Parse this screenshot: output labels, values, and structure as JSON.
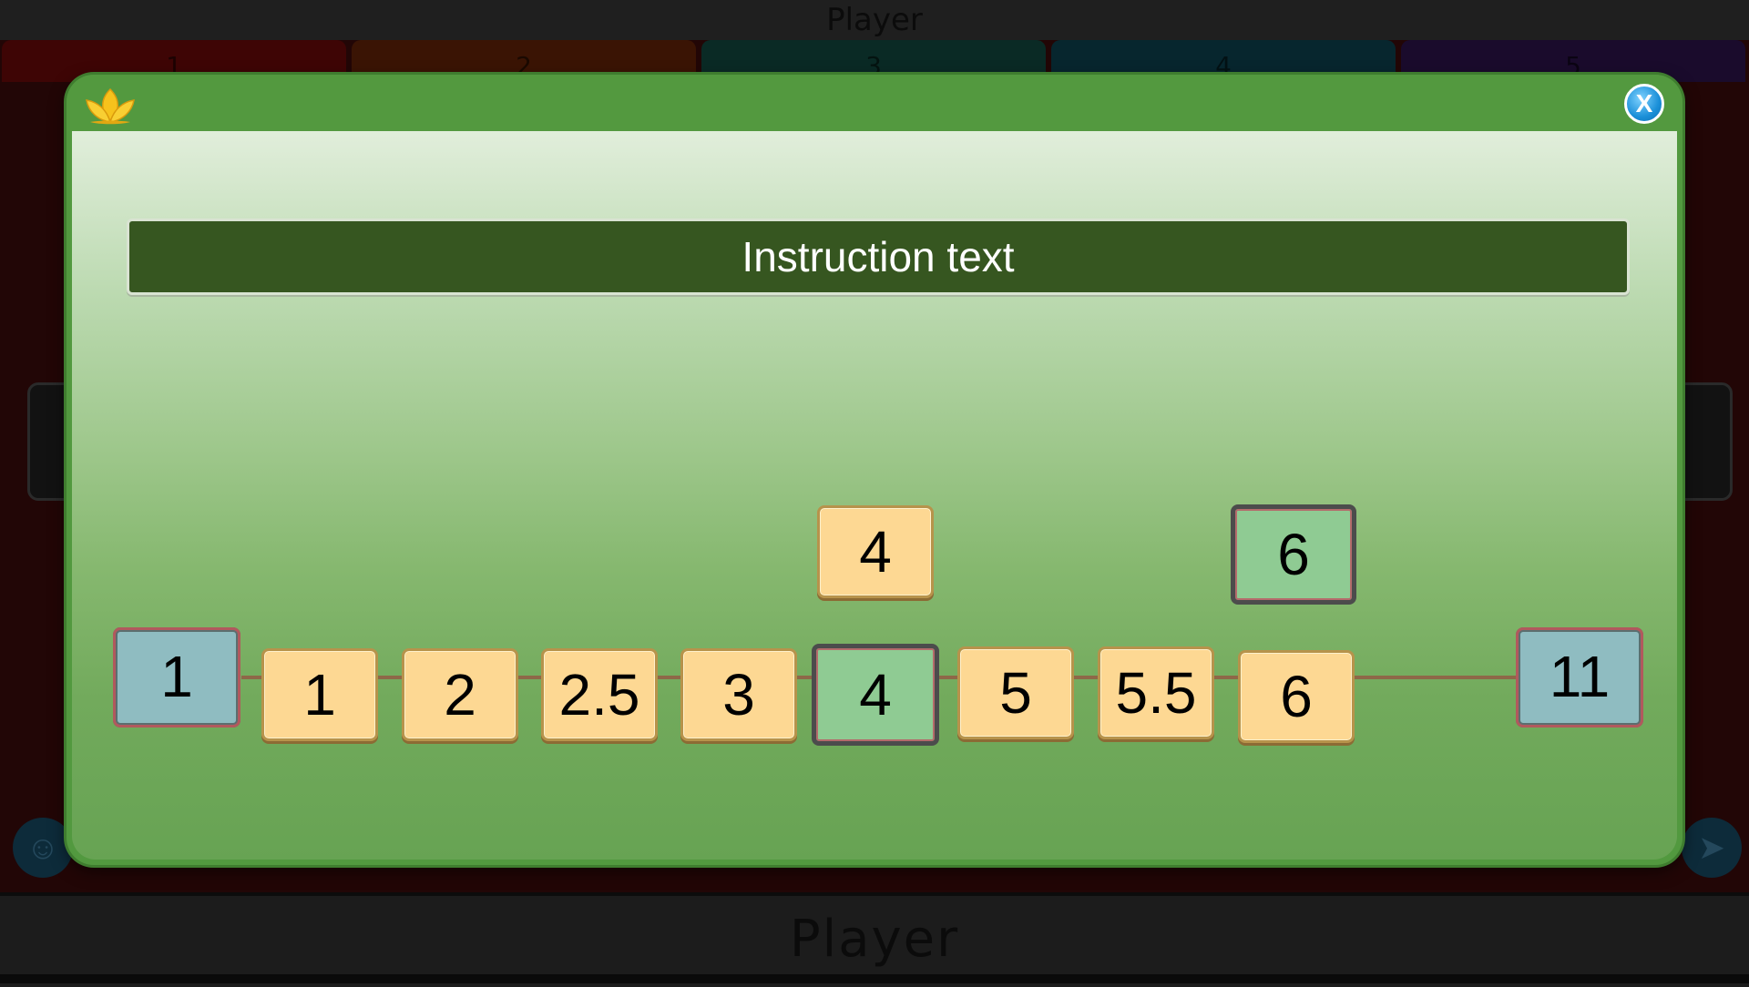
{
  "app": {
    "top_title": "Player",
    "bottom_title": "Player"
  },
  "player_tabs": [
    {
      "label": "1",
      "color": "#3e0505"
    },
    {
      "label": "2",
      "color": "#3a1404"
    },
    {
      "label": "3",
      "color": "#0a2a25"
    },
    {
      "label": "4",
      "color": "#07262e"
    },
    {
      "label": "5",
      "color": "#1a0b2c"
    }
  ],
  "modal": {
    "header_icon": "lotus-icon",
    "close_label": "X",
    "instruction": "Instruction text",
    "number_line": {
      "start_label": "1",
      "end_label": "11",
      "placed_tiles": [
        {
          "value": "4",
          "style": "yellow"
        },
        {
          "value": "6",
          "style": "green"
        }
      ],
      "tray_tiles": [
        {
          "value": "1",
          "style": "yellow"
        },
        {
          "value": "2",
          "style": "yellow"
        },
        {
          "value": "2.5",
          "style": "yellow"
        },
        {
          "value": "3",
          "style": "yellow"
        },
        {
          "value": "4",
          "style": "green"
        },
        {
          "value": "5",
          "style": "yellow"
        },
        {
          "value": "5.5",
          "style": "yellow"
        },
        {
          "value": "6",
          "style": "yellow"
        }
      ]
    }
  },
  "colors": {
    "modal_green": "#52993f",
    "instruction_bg": "#365620",
    "tile_yellow": "#fdd893",
    "tile_green": "#8fcb93",
    "end_label_blue": "#8fbcc1"
  }
}
